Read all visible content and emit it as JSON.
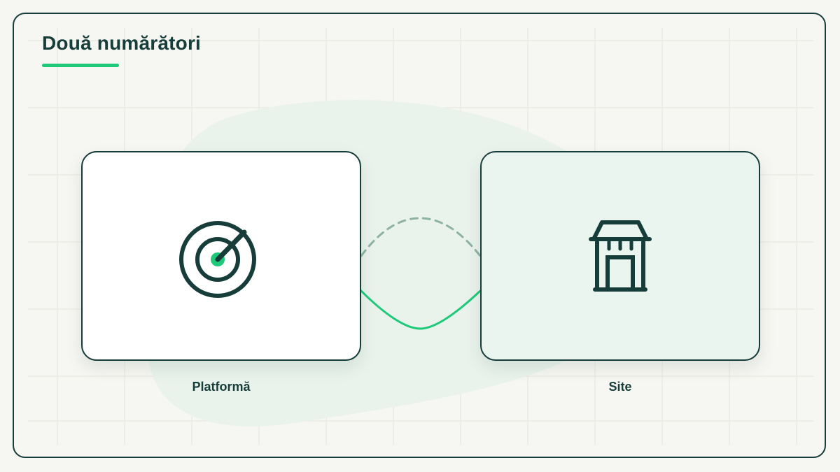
{
  "header": {
    "title": "Două numărători"
  },
  "nodes": [
    {
      "id": "platform",
      "label": "Platformă",
      "icon": "target-icon"
    },
    {
      "id": "site",
      "label": "Site",
      "icon": "storefront-icon"
    }
  ],
  "edges": [
    {
      "from": "platform",
      "to": "site",
      "style": "dashed"
    },
    {
      "from": "platform",
      "to": "site",
      "style": "solid"
    }
  ],
  "colors": {
    "ink": "#173d3a",
    "accent": "#1ec97a",
    "dashed_line": "#8fb3a2",
    "blob": "#e9f3ec",
    "background": "#f6f6f2",
    "site_card": "#e9f5ee"
  }
}
